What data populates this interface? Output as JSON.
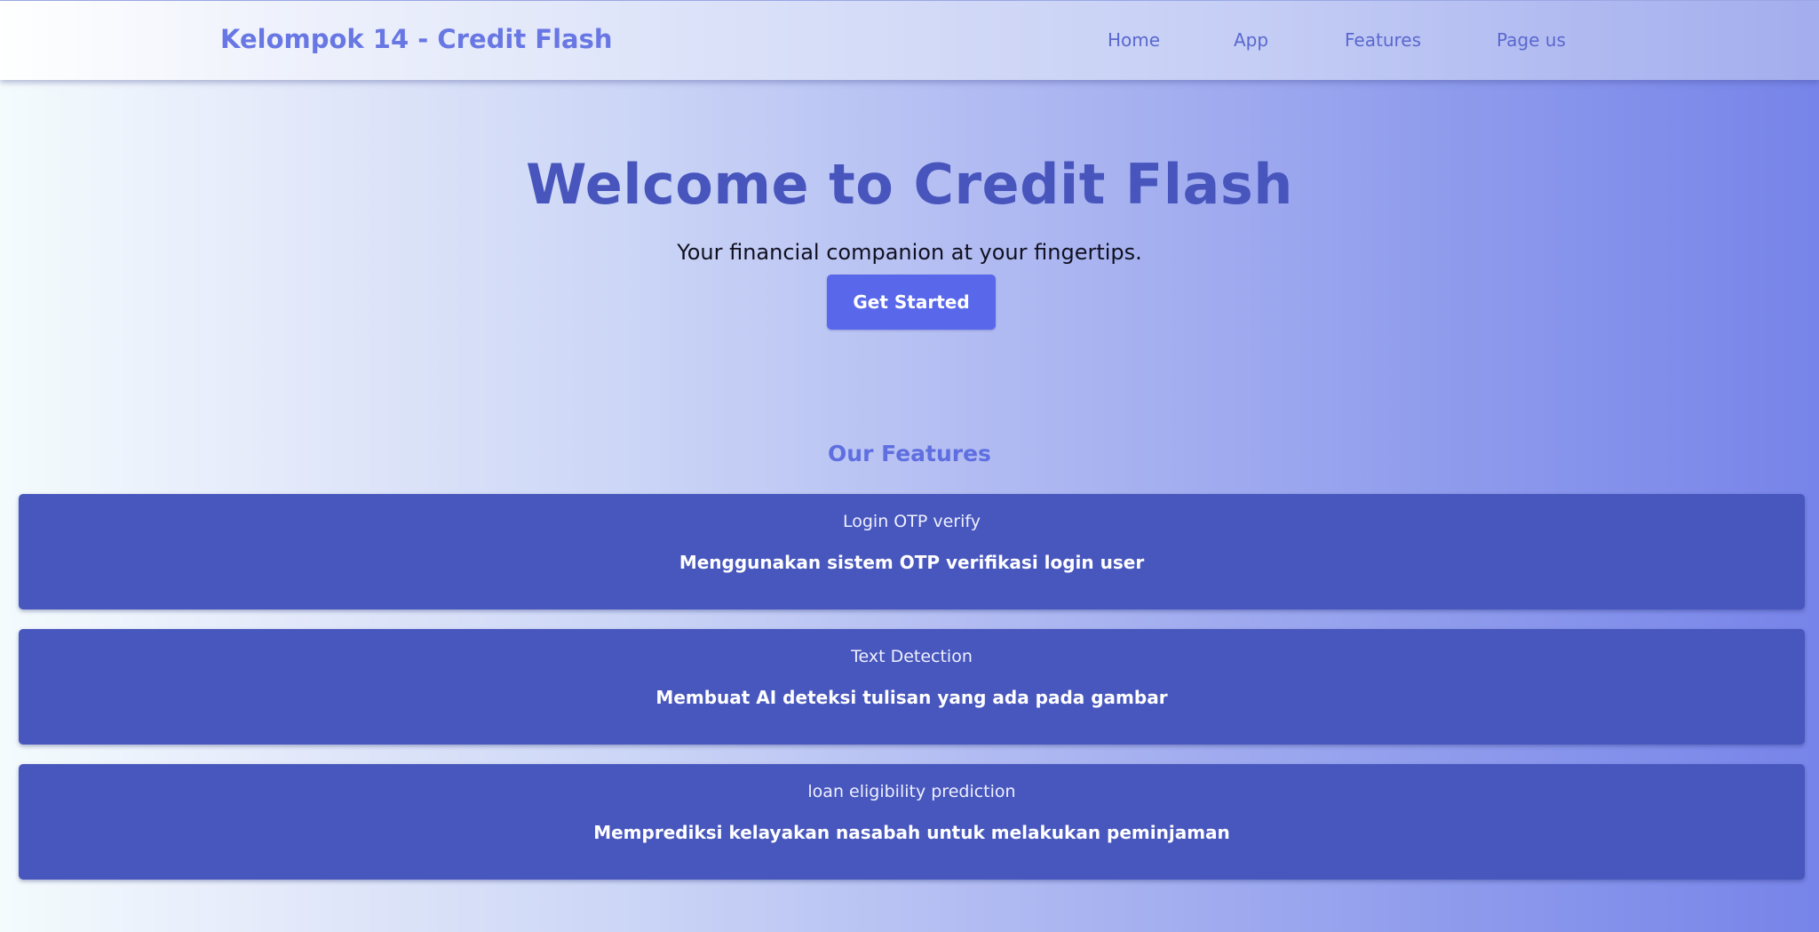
{
  "navbar": {
    "brand": "Kelompok 14 - Credit Flash",
    "links": [
      "Home",
      "App",
      "Features",
      "Page us"
    ]
  },
  "hero": {
    "title": "Welcome to Credit Flash",
    "subtitle": "Your financial companion at your fingertips.",
    "cta_label": "Get Started"
  },
  "features": {
    "heading": "Our Features",
    "items": [
      {
        "title": "Login OTP verify",
        "description": "Menggunakan sistem OTP verifikasi login user"
      },
      {
        "title": "Text Detection",
        "description": "Membuat AI deteksi tulisan yang ada pada gambar"
      },
      {
        "title": "loan eligibility prediction",
        "description": "Memprediksi kelayakan nasabah untuk melakukan peminjaman"
      }
    ]
  },
  "colors": {
    "accent": "#5968ea",
    "card": "#4857bd",
    "title": "#4755bd"
  }
}
